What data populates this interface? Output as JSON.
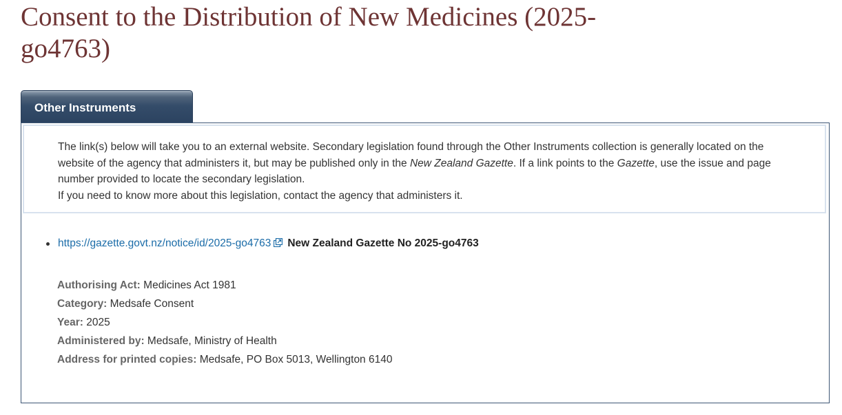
{
  "page": {
    "title": "Consent to the Distribution of New Medicines (2025-go4763)"
  },
  "tab": {
    "label": "Other Instruments"
  },
  "notice": {
    "part1": "The link(s) below will take you to an external website. Secondary legislation found through the Other Instruments collection is generally located on the website of the agency that administers it, but may be published only in the ",
    "italic1": "New Zealand Gazette",
    "part2": ". If a link points to the ",
    "italic2": "Gazette",
    "part3": ", use the issue and page number provided to locate the secondary legislation.",
    "line2": "If you need to know more about this legislation, contact the agency that administers it."
  },
  "links": [
    {
      "url": "https://gazette.govt.nz/notice/id/2025-go4763",
      "title": "New Zealand Gazette No 2025-go4763",
      "icon": "external-link-icon"
    }
  ],
  "details": {
    "authorising_act": {
      "label": "Authorising Act:",
      "value": "Medicines Act 1981"
    },
    "category": {
      "label": "Category:",
      "value": "Medsafe Consent"
    },
    "year": {
      "label": "Year:",
      "value": "2025"
    },
    "administered_by": {
      "label": "Administered by:",
      "value": "Medsafe, Ministry of Health"
    },
    "address": {
      "label": "Address for printed copies:",
      "value": "Medsafe, PO Box 5013, Wellington 6140"
    }
  },
  "colors": {
    "title": "#6e3434",
    "tab_background": "#2b4260",
    "link": "#1b6ca8",
    "panel_border": "#3c5574"
  }
}
